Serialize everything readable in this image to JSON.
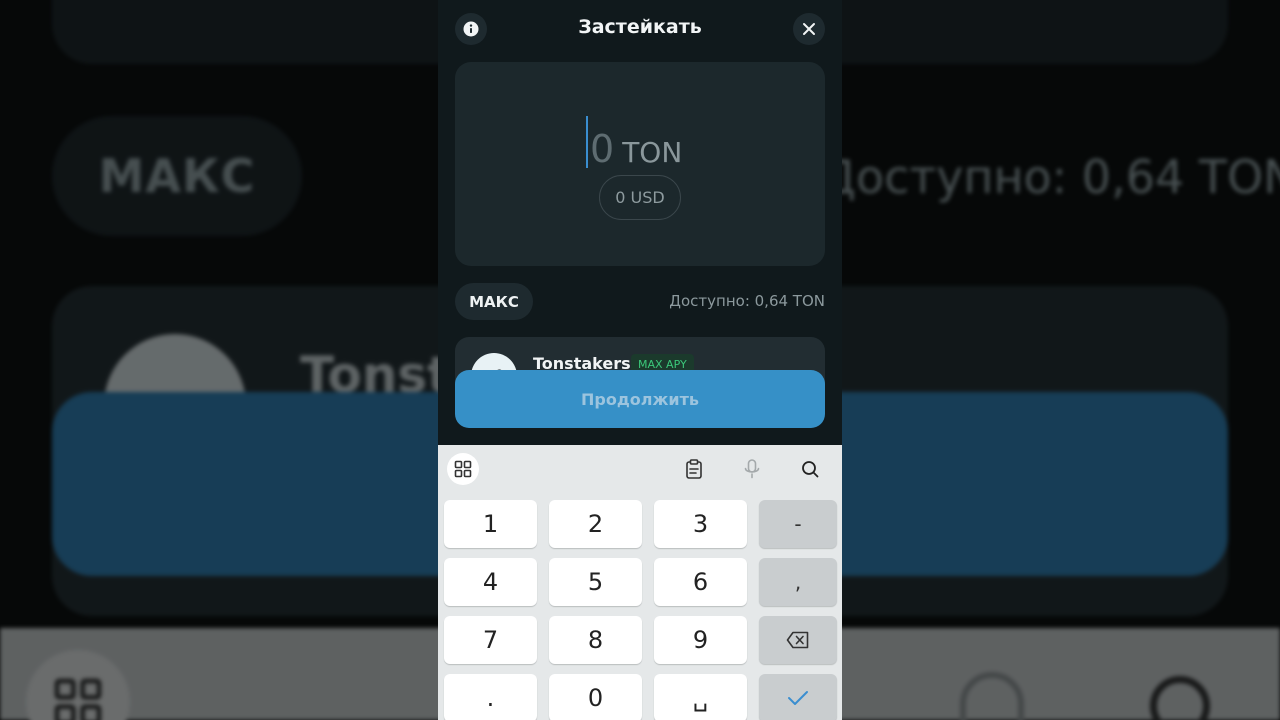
{
  "background": {
    "max_label": "МАКС",
    "available_text": "Доступно: 0,64 TON",
    "provider_name": "Tonst"
  },
  "header": {
    "title": "Застейкать",
    "info_icon": "info-icon",
    "close_icon": "close-icon"
  },
  "amount": {
    "value": "0",
    "currency": "TON",
    "fiat": "0 USD"
  },
  "controls": {
    "max_label": "МАКС",
    "available_text": "Доступно: 0,64 TON"
  },
  "provider": {
    "name": "Tonstakers",
    "badge": "MAX APY"
  },
  "cta": {
    "label": "Продолжить"
  },
  "keyboard": {
    "toolbar_icons": [
      "grid-icon",
      "clipboard-icon",
      "mic-icon",
      "search-icon"
    ],
    "keys": {
      "k1": "1",
      "k2": "2",
      "k3": "3",
      "minus": "-",
      "k4": "4",
      "k5": "5",
      "k6": "6",
      "comma": ",",
      "k7": "7",
      "k8": "8",
      "k9": "9",
      "dot": ".",
      "k0": "0",
      "space": "␣"
    }
  },
  "colors": {
    "accent": "#3690c7",
    "badge_green": "#3bc77a",
    "sheet_bg": "#10191c"
  }
}
